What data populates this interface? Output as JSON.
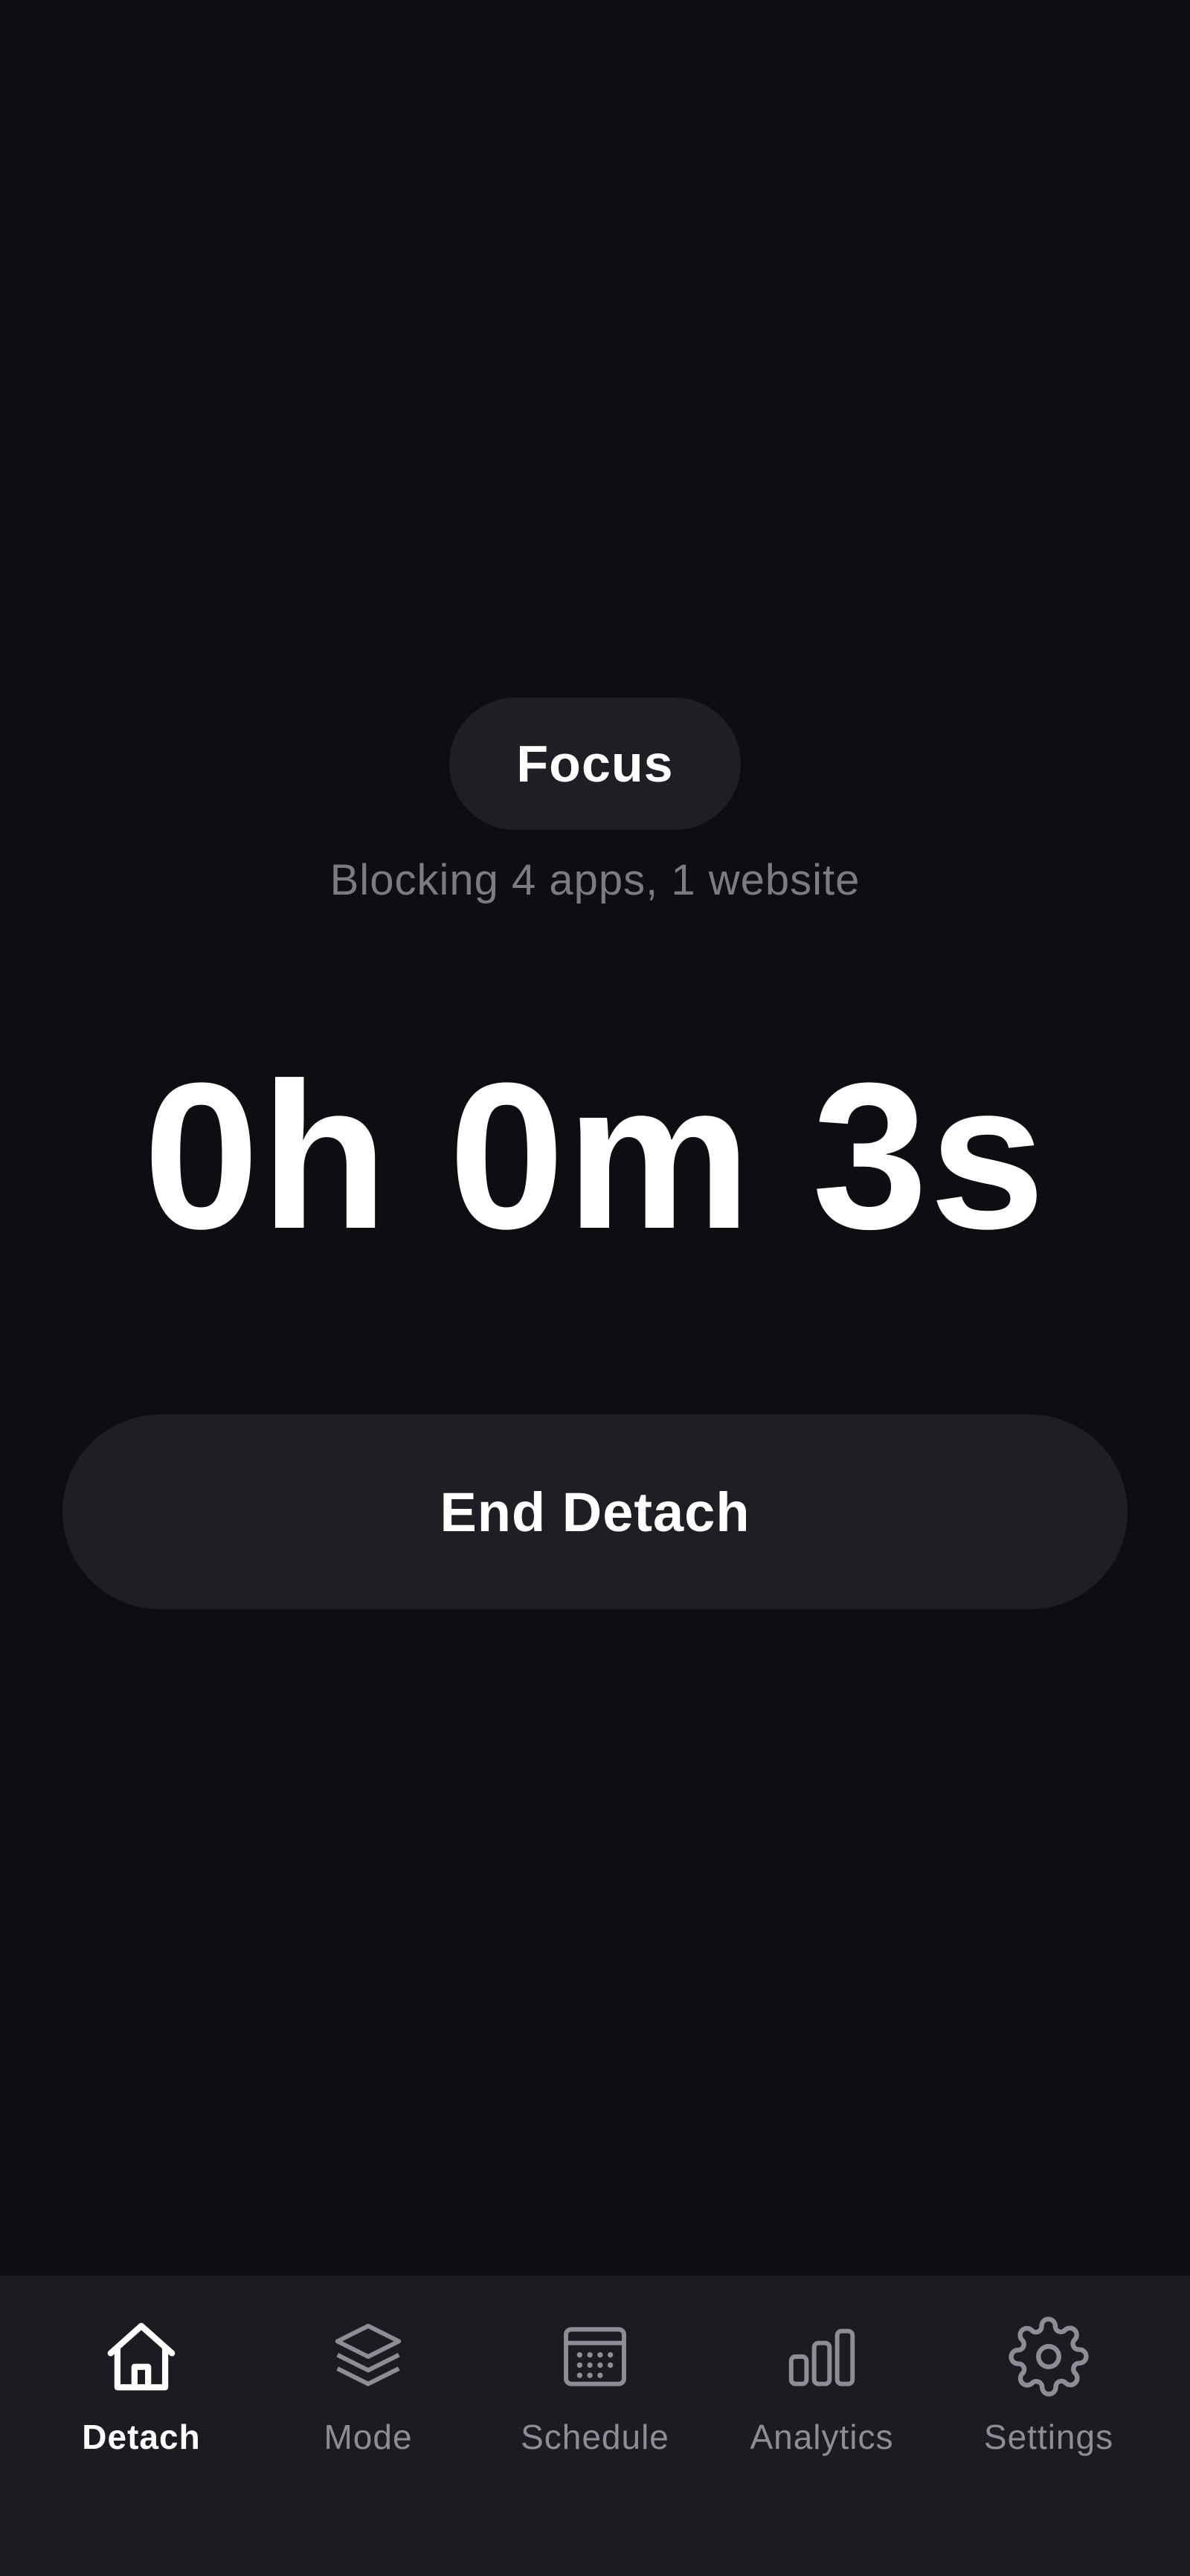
{
  "session": {
    "mode_label": "Focus",
    "blocking_summary": "Blocking 4 apps, 1 website",
    "timer": "0h 0m 3s",
    "end_button_label": "End Detach"
  },
  "tabs": [
    {
      "label": "Detach",
      "icon": "home-icon",
      "active": true
    },
    {
      "label": "Mode",
      "icon": "layers-icon",
      "active": false
    },
    {
      "label": "Schedule",
      "icon": "calendar-icon",
      "active": false
    },
    {
      "label": "Analytics",
      "icon": "bar-chart-icon",
      "active": false
    },
    {
      "label": "Settings",
      "icon": "gear-icon",
      "active": false
    }
  ],
  "colors": {
    "background": "#0e0d12",
    "surface": "#1f1e24",
    "tab_bar": "#1c1b22",
    "text_primary": "#ffffff",
    "text_secondary": "#7c7b83",
    "tab_inactive": "#8e8d95"
  }
}
